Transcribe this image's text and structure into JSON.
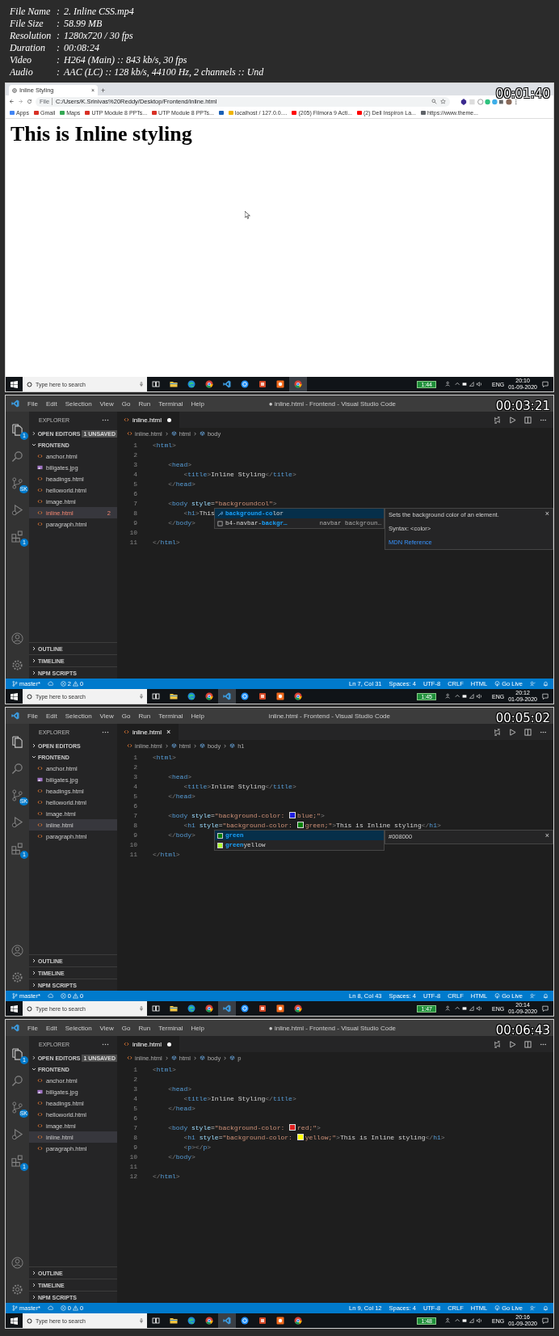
{
  "info": [
    {
      "label": "File Name",
      "colon": ":",
      "value": "2. Inline CSS.mp4"
    },
    {
      "label": "File Size",
      "colon": ":",
      "value": "58.99 MB"
    },
    {
      "label": "Resolution",
      "colon": ":",
      "value": "1280x720 / 30 fps"
    },
    {
      "label": "Duration",
      "colon": ":",
      "value": "00:08:24"
    },
    {
      "label": "Video",
      "colon": ":",
      "value": "H264 (Main) :: 843 kb/s, 30 fps"
    },
    {
      "label": "Audio",
      "colon": ":",
      "value": "AAC (LC) :: 128 kb/s, 44100 Hz, 2 channels :: Und"
    }
  ],
  "frames": [
    {
      "kind": "browser",
      "timestamp": "00:01:40",
      "tab": {
        "title": "Inline Styling",
        "close": "×",
        "new_tab": "+"
      },
      "address": {
        "scheme": "File",
        "url": "C:/Users/K.Srinivas%20Reddy/Desktop/Frontend/inline.html"
      },
      "bookmarks": [
        {
          "kind": "apps",
          "label": "Apps"
        },
        {
          "kind": "mail",
          "label": "Gmail"
        },
        {
          "kind": "maps",
          "label": "Maps"
        },
        {
          "kind": "mail",
          "label": "UTP Module 8 PPTs..."
        },
        {
          "kind": "mail",
          "label": "UTP Module 8 PPTs..."
        },
        {
          "kind": "square"
        },
        {
          "kind": "page",
          "label": "localhost / 127.0.0...."
        },
        {
          "kind": "video",
          "label": "(205) Filmora 9 Acti..."
        },
        {
          "kind": "video",
          "label": "(2) Dell Inspiron La..."
        },
        {
          "kind": "globe",
          "label": "https://www.theme..."
        }
      ],
      "heading": "This is Inline styling",
      "taskbar": {
        "search": "Type here to search",
        "battery": "1:44",
        "language": "ENG",
        "time": "20:10",
        "date": "01-09-2020",
        "apps": [
          {
            "kind": "taskview",
            "active": false
          },
          {
            "kind": "folder",
            "active": false
          },
          {
            "kind": "edge",
            "active": false
          },
          {
            "kind": "chrome",
            "active": false
          },
          {
            "kind": "vscode",
            "active": false
          },
          {
            "kind": "circle",
            "active": false
          },
          {
            "kind": "slides",
            "active": false
          },
          {
            "kind": "recorder",
            "active": false
          },
          {
            "kind": "chrome",
            "active": true
          }
        ]
      }
    },
    {
      "kind": "vscode",
      "timestamp": "00:03:21",
      "menu": [
        "File",
        "Edit",
        "Selection",
        "View",
        "Go",
        "Run",
        "Terminal",
        "Help"
      ],
      "title": "● inline.html - Frontend - Visual Studio Code",
      "activity": [
        {
          "kind": "files",
          "badge": "1"
        },
        {
          "kind": "search"
        },
        {
          "kind": "scm",
          "badge": "SK"
        },
        {
          "kind": "debug"
        },
        {
          "kind": "extensions",
          "badge": "1"
        }
      ],
      "explorer": {
        "title": "EXPLORER",
        "open_editors": {
          "label": "OPEN EDITORS",
          "expanded": false,
          "badge": "1 UNSAVED"
        },
        "folder": {
          "label": "FRONTEND",
          "expanded": true
        },
        "files": [
          {
            "name": "anchor.html",
            "kind": "html",
            "selected": false,
            "error": false
          },
          {
            "name": "billgates.jpg",
            "kind": "image",
            "selected": false,
            "error": false
          },
          {
            "name": "headings.html",
            "kind": "html",
            "selected": false,
            "error": false
          },
          {
            "name": "helloworld.html",
            "kind": "html",
            "selected": false,
            "error": false
          },
          {
            "name": "image.html",
            "kind": "html",
            "selected": false,
            "error": false
          },
          {
            "name": "inline.html",
            "kind": "html",
            "selected": true,
            "error": true,
            "badge": "2"
          },
          {
            "name": "paragraph.html",
            "kind": "html",
            "selected": false,
            "error": false
          }
        ],
        "sections": [
          {
            "label": "OUTLINE",
            "expanded": false
          },
          {
            "label": "TIMELINE",
            "expanded": false
          },
          {
            "label": "NPM SCRIPTS",
            "expanded": false
          }
        ]
      },
      "tab": {
        "label": "inline.html",
        "dirty": true
      },
      "breadcrumbs": [
        "inline.html",
        "html",
        "body"
      ],
      "code": [
        {
          "number": "1",
          "tokens": [
            {
              "kind": "p",
              "text": "<"
            },
            {
              "kind": "tag",
              "text": "html"
            },
            {
              "kind": "p",
              "text": ">"
            }
          ]
        },
        {
          "number": "2"
        },
        {
          "number": "3",
          "tokens": [
            {
              "kind": "p",
              "text": "    <"
            },
            {
              "kind": "tag",
              "text": "head"
            },
            {
              "kind": "p",
              "text": ">"
            }
          ]
        },
        {
          "number": "4",
          "tokens": [
            {
              "kind": "p",
              "text": "        <"
            },
            {
              "kind": "tag",
              "text": "title"
            },
            {
              "kind": "p",
              "text": ">"
            },
            {
              "kind": "text",
              "text": "Inline Styling"
            },
            {
              "kind": "p",
              "text": "</"
            },
            {
              "kind": "tag",
              "text": "title"
            },
            {
              "kind": "p",
              "text": ">"
            }
          ]
        },
        {
          "number": "5",
          "tokens": [
            {
              "kind": "p",
              "text": "    </"
            },
            {
              "kind": "tag",
              "text": "head"
            },
            {
              "kind": "p",
              "text": ">"
            }
          ]
        },
        {
          "number": "6"
        },
        {
          "number": "7",
          "tokens": [
            {
              "kind": "p",
              "text": "    <"
            },
            {
              "kind": "tag",
              "text": "body"
            },
            {
              "kind": "attr",
              "text": " style"
            },
            {
              "kind": "text",
              "text": "="
            },
            {
              "kind": "str",
              "text": "\"backgroundcol\""
            },
            {
              "kind": "p",
              "text": ">"
            }
          ],
          "suggest": {
            "items": [
              {
                "kind": "property",
                "selected": true,
                "parts": [
                  {
                    "text": "background-co",
                    "match": true
                  },
                  {
                    "text": "lor",
                    "match": false
                  }
                ]
              },
              {
                "kind": "snippet",
                "selected": false,
                "parts": [
                  {
                    "text": "b4-navbar-",
                    "match": false
                  },
                  {
                    "text": "backgr…",
                    "match": true
                  }
                ],
                "detail": "navbar backgroun…"
              }
            ],
            "details": {
              "description": "Sets the background color of an element.",
              "syntax": "Syntax: <color>",
              "link": "MDN Reference",
              "close": "×"
            }
          }
        },
        {
          "number": "8",
          "tokens": [
            {
              "kind": "p",
              "text": "        <"
            },
            {
              "kind": "tag",
              "text": "h1"
            },
            {
              "kind": "p",
              "text": ">"
            },
            {
              "kind": "text",
              "text": "This"
            }
          ]
        },
        {
          "number": "9",
          "tokens": [
            {
              "kind": "p",
              "text": "    </"
            },
            {
              "kind": "tag",
              "text": "body"
            },
            {
              "kind": "p",
              "text": ">"
            }
          ]
        },
        {
          "number": "10"
        },
        {
          "number": "11",
          "tokens": [
            {
              "kind": "p",
              "text": "</"
            },
            {
              "kind": "tag",
              "text": "html"
            },
            {
              "kind": "p",
              "text": ">"
            }
          ]
        }
      ],
      "status": {
        "branch": "master*",
        "errors": "2",
        "warnings": "0",
        "position": "Ln 7, Col 31",
        "spaces": "Spaces: 4",
        "encoding": "UTF-8",
        "eol": "CRLF",
        "language": "HTML",
        "live": "Go Live"
      },
      "taskbar": {
        "search": "Type here to search",
        "battery": "1:45",
        "language": "ENG",
        "time": "20:12",
        "date": "01-09-2020",
        "apps": [
          {
            "kind": "taskview",
            "active": false
          },
          {
            "kind": "folder",
            "active": false
          },
          {
            "kind": "edge",
            "active": false
          },
          {
            "kind": "chrome",
            "active": false
          },
          {
            "kind": "vscode",
            "active": true
          },
          {
            "kind": "circle",
            "active": false
          },
          {
            "kind": "slides",
            "active": false
          },
          {
            "kind": "recorder",
            "active": false
          },
          {
            "kind": "chrome",
            "active": false
          }
        ]
      }
    },
    {
      "kind": "vscode",
      "timestamp": "00:05:02",
      "menu": [
        "File",
        "Edit",
        "Selection",
        "View",
        "Go",
        "Run",
        "Terminal",
        "Help"
      ],
      "title": "inline.html - Frontend - Visual Studio Code",
      "activity": [
        {
          "kind": "files"
        },
        {
          "kind": "search"
        },
        {
          "kind": "scm",
          "badge": "SK"
        },
        {
          "kind": "debug"
        },
        {
          "kind": "extensions",
          "badge": "1"
        }
      ],
      "explorer": {
        "title": "EXPLORER",
        "open_editors": {
          "label": "OPEN EDITORS",
          "expanded": false
        },
        "folder": {
          "label": "FRONTEND",
          "expanded": true
        },
        "files": [
          {
            "name": "anchor.html",
            "kind": "html",
            "selected": false,
            "error": false
          },
          {
            "name": "billgates.jpg",
            "kind": "image",
            "selected": false,
            "error": false
          },
          {
            "name": "headings.html",
            "kind": "html",
            "selected": false,
            "error": false
          },
          {
            "name": "helloworld.html",
            "kind": "html",
            "selected": false,
            "error": false
          },
          {
            "name": "image.html",
            "kind": "html",
            "selected": false,
            "error": false
          },
          {
            "name": "inline.html",
            "kind": "html",
            "selected": true,
            "error": false
          },
          {
            "name": "paragraph.html",
            "kind": "html",
            "selected": false,
            "error": false
          }
        ],
        "sections": [
          {
            "label": "OUTLINE",
            "expanded": false
          },
          {
            "label": "TIMELINE",
            "expanded": false
          },
          {
            "label": "NPM SCRIPTS",
            "expanded": false
          }
        ]
      },
      "tab": {
        "label": "inline.html",
        "dirty": false,
        "close": "×"
      },
      "breadcrumbs": [
        "inline.html",
        "html",
        "body",
        "h1"
      ],
      "code": [
        {
          "number": "1",
          "tokens": [
            {
              "kind": "p",
              "text": "<"
            },
            {
              "kind": "tag",
              "text": "html"
            },
            {
              "kind": "p",
              "text": ">"
            }
          ]
        },
        {
          "number": "2"
        },
        {
          "number": "3",
          "tokens": [
            {
              "kind": "p",
              "text": "    <"
            },
            {
              "kind": "tag",
              "text": "head"
            },
            {
              "kind": "p",
              "text": ">"
            }
          ]
        },
        {
          "number": "4",
          "tokens": [
            {
              "kind": "p",
              "text": "        <"
            },
            {
              "kind": "tag",
              "text": "title"
            },
            {
              "kind": "p",
              "text": ">"
            },
            {
              "kind": "text",
              "text": "Inline Styling"
            },
            {
              "kind": "p",
              "text": "</"
            },
            {
              "kind": "tag",
              "text": "title"
            },
            {
              "kind": "p",
              "text": ">"
            }
          ]
        },
        {
          "number": "5",
          "tokens": [
            {
              "kind": "p",
              "text": "    </"
            },
            {
              "kind": "tag",
              "text": "head"
            },
            {
              "kind": "p",
              "text": ">"
            }
          ]
        },
        {
          "number": "6"
        },
        {
          "number": "7",
          "tokens": [
            {
              "kind": "p",
              "text": "    <"
            },
            {
              "kind": "tag",
              "text": "body"
            },
            {
              "kind": "attr",
              "text": " style"
            },
            {
              "kind": "text",
              "text": "="
            },
            {
              "kind": "str",
              "text": "\"background-color: "
            },
            {
              "kind": "swatch",
              "color": "#2020e0"
            },
            {
              "kind": "str",
              "text": "blue;\""
            },
            {
              "kind": "p",
              "text": ">"
            }
          ]
        },
        {
          "number": "8",
          "tokens": [
            {
              "kind": "p",
              "text": "        <"
            },
            {
              "kind": "tag",
              "text": "h1"
            },
            {
              "kind": "attr",
              "text": " style"
            },
            {
              "kind": "text",
              "text": "="
            },
            {
              "kind": "str",
              "text": "\"background-color: "
            },
            {
              "kind": "swatch",
              "color": "#008000"
            },
            {
              "kind": "str",
              "text": "green;\""
            },
            {
              "kind": "p",
              "text": ">"
            },
            {
              "kind": "text",
              "text": "This is Inline styling"
            },
            {
              "kind": "p",
              "text": "</"
            },
            {
              "kind": "tag",
              "text": "h1"
            },
            {
              "kind": "p",
              "text": ">"
            }
          ],
          "suggest": {
            "items": [
              {
                "kind": "color",
                "color": "#008000",
                "selected": true,
                "parts": [
                  {
                    "text": "green",
                    "match": true
                  }
                ]
              },
              {
                "kind": "color",
                "color": "#adff2f",
                "selected": false,
                "parts": [
                  {
                    "text": "green",
                    "match": true
                  },
                  {
                    "text": "yellow",
                    "match": false
                  }
                ]
              }
            ],
            "details": {
              "description": "#008000",
              "close": "×"
            }
          }
        },
        {
          "number": "9",
          "tokens": [
            {
              "kind": "p",
              "text": "    </"
            },
            {
              "kind": "tag",
              "text": "body"
            },
            {
              "kind": "p",
              "text": ">"
            }
          ]
        },
        {
          "number": "10"
        },
        {
          "number": "11",
          "tokens": [
            {
              "kind": "p",
              "text": "</"
            },
            {
              "kind": "tag",
              "text": "html"
            },
            {
              "kind": "p",
              "text": ">"
            }
          ]
        }
      ],
      "status": {
        "branch": "master*",
        "errors": "0",
        "warnings": "0",
        "position": "Ln 8, Col 43",
        "spaces": "Spaces: 4",
        "encoding": "UTF-8",
        "eol": "CRLF",
        "language": "HTML",
        "live": "Go Live"
      },
      "taskbar": {
        "search": "Type here to search",
        "battery": "1:47",
        "language": "ENG",
        "time": "20:14",
        "date": "01-09-2020",
        "apps": [
          {
            "kind": "taskview",
            "active": false
          },
          {
            "kind": "folder",
            "active": false
          },
          {
            "kind": "edge",
            "active": false
          },
          {
            "kind": "chrome",
            "active": false
          },
          {
            "kind": "vscode",
            "active": true
          },
          {
            "kind": "circle",
            "active": false
          },
          {
            "kind": "slides",
            "active": false
          },
          {
            "kind": "recorder",
            "active": false
          },
          {
            "kind": "chrome",
            "active": false
          }
        ]
      }
    },
    {
      "kind": "vscode",
      "timestamp": "00:06:43",
      "menu": [
        "File",
        "Edit",
        "Selection",
        "View",
        "Go",
        "Run",
        "Terminal",
        "Help"
      ],
      "title": "● inline.html - Frontend - Visual Studio Code",
      "activity": [
        {
          "kind": "files",
          "badge": "1"
        },
        {
          "kind": "search"
        },
        {
          "kind": "scm",
          "badge": "SK"
        },
        {
          "kind": "debug"
        },
        {
          "kind": "extensions",
          "badge": "1"
        }
      ],
      "explorer": {
        "title": "EXPLORER",
        "open_editors": {
          "label": "OPEN EDITORS",
          "expanded": false,
          "badge": "1 UNSAVED"
        },
        "folder": {
          "label": "FRONTEND",
          "expanded": true
        },
        "files": [
          {
            "name": "anchor.html",
            "kind": "html",
            "selected": false,
            "error": false
          },
          {
            "name": "billgates.jpg",
            "kind": "image",
            "selected": false,
            "error": false
          },
          {
            "name": "headings.html",
            "kind": "html",
            "selected": false,
            "error": false
          },
          {
            "name": "helloworld.html",
            "kind": "html",
            "selected": false,
            "error": false
          },
          {
            "name": "image.html",
            "kind": "html",
            "selected": false,
            "error": false
          },
          {
            "name": "inline.html",
            "kind": "html",
            "selected": true,
            "error": false
          },
          {
            "name": "paragraph.html",
            "kind": "html",
            "selected": false,
            "error": false
          }
        ],
        "sections": [
          {
            "label": "OUTLINE",
            "expanded": false
          },
          {
            "label": "TIMELINE",
            "expanded": false
          },
          {
            "label": "NPM SCRIPTS",
            "expanded": false
          }
        ]
      },
      "tab": {
        "label": "inline.html",
        "dirty": true
      },
      "breadcrumbs": [
        "inline.html",
        "html",
        "body",
        "p"
      ],
      "code": [
        {
          "number": "1",
          "tokens": [
            {
              "kind": "p",
              "text": "<"
            },
            {
              "kind": "tag",
              "text": "html"
            },
            {
              "kind": "p",
              "text": ">"
            }
          ]
        },
        {
          "number": "2"
        },
        {
          "number": "3",
          "tokens": [
            {
              "kind": "p",
              "text": "    <"
            },
            {
              "kind": "tag",
              "text": "head"
            },
            {
              "kind": "p",
              "text": ">"
            }
          ]
        },
        {
          "number": "4",
          "tokens": [
            {
              "kind": "p",
              "text": "        <"
            },
            {
              "kind": "tag",
              "text": "title"
            },
            {
              "kind": "p",
              "text": ">"
            },
            {
              "kind": "text",
              "text": "Inline Styling"
            },
            {
              "kind": "p",
              "text": "</"
            },
            {
              "kind": "tag",
              "text": "title"
            },
            {
              "kind": "p",
              "text": ">"
            }
          ]
        },
        {
          "number": "5",
          "tokens": [
            {
              "kind": "p",
              "text": "    </"
            },
            {
              "kind": "tag",
              "text": "head"
            },
            {
              "kind": "p",
              "text": ">"
            }
          ]
        },
        {
          "number": "6"
        },
        {
          "number": "7",
          "tokens": [
            {
              "kind": "p",
              "text": "    <"
            },
            {
              "kind": "tag",
              "text": "body"
            },
            {
              "kind": "attr",
              "text": " style"
            },
            {
              "kind": "text",
              "text": "="
            },
            {
              "kind": "str",
              "text": "\"background-color: "
            },
            {
              "kind": "swatch",
              "color": "#e02020"
            },
            {
              "kind": "str",
              "text": "red;\""
            },
            {
              "kind": "p",
              "text": ">"
            }
          ]
        },
        {
          "number": "8",
          "tokens": [
            {
              "kind": "p",
              "text": "        <"
            },
            {
              "kind": "tag",
              "text": "h1"
            },
            {
              "kind": "attr",
              "text": " style"
            },
            {
              "kind": "text",
              "text": "="
            },
            {
              "kind": "str",
              "text": "\"background-color: "
            },
            {
              "kind": "swatch",
              "color": "#ffff00"
            },
            {
              "kind": "str",
              "text": "yellow;\""
            },
            {
              "kind": "p",
              "text": ">"
            },
            {
              "kind": "text",
              "text": "This is Inline styling"
            },
            {
              "kind": "p",
              "text": "</"
            },
            {
              "kind": "tag",
              "text": "h1"
            },
            {
              "kind": "p",
              "text": ">"
            }
          ]
        },
        {
          "number": "9",
          "tokens": [
            {
              "kind": "p",
              "text": "        <"
            },
            {
              "kind": "tag",
              "text": "p"
            },
            {
              "kind": "p",
              "text": "></"
            },
            {
              "kind": "tag",
              "text": "p"
            },
            {
              "kind": "p",
              "text": ">"
            }
          ]
        },
        {
          "number": "10",
          "tokens": [
            {
              "kind": "p",
              "text": "    </"
            },
            {
              "kind": "tag",
              "text": "body"
            },
            {
              "kind": "p",
              "text": ">"
            }
          ]
        },
        {
          "number": "11"
        },
        {
          "number": "12",
          "tokens": [
            {
              "kind": "p",
              "text": "</"
            },
            {
              "kind": "tag",
              "text": "html"
            },
            {
              "kind": "p",
              "text": ">"
            }
          ]
        }
      ],
      "status": {
        "branch": "master*",
        "errors": "0",
        "warnings": "0",
        "position": "Ln 9, Col 12",
        "spaces": "Spaces: 4",
        "encoding": "UTF-8",
        "eol": "CRLF",
        "language": "HTML",
        "live": "Go Live"
      },
      "taskbar": {
        "search": "Type here to search",
        "battery": "1:48",
        "language": "ENG",
        "time": "20:16",
        "date": "01-09-2020",
        "apps": [
          {
            "kind": "taskview",
            "active": false
          },
          {
            "kind": "folder",
            "active": false
          },
          {
            "kind": "edge",
            "active": false
          },
          {
            "kind": "chrome",
            "active": false
          },
          {
            "kind": "vscode",
            "active": true
          },
          {
            "kind": "circle",
            "active": false
          },
          {
            "kind": "slides",
            "active": false
          },
          {
            "kind": "recorder",
            "active": false
          },
          {
            "kind": "chrome",
            "active": false
          }
        ]
      }
    }
  ]
}
